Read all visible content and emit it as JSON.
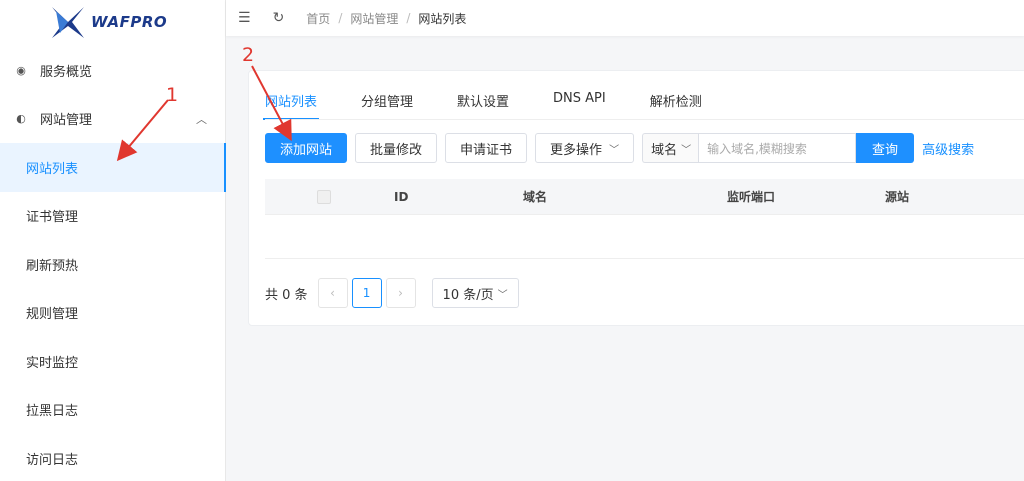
{
  "brand": {
    "name": "WAFPRO"
  },
  "header": {
    "breadcrumb": [
      "首页",
      "网站管理",
      "网站列表"
    ]
  },
  "sidebar": {
    "items": [
      {
        "label": "服务概览",
        "icon": "dashboard-icon"
      },
      {
        "label": "网站管理",
        "icon": "globe-icon"
      },
      {
        "label": "网站列表"
      },
      {
        "label": "证书管理"
      },
      {
        "label": "刷新预热"
      },
      {
        "label": "规则管理"
      },
      {
        "label": "实时监控"
      },
      {
        "label": "拉黑日志"
      },
      {
        "label": "访问日志"
      }
    ]
  },
  "tabs": [
    "网站列表",
    "分组管理",
    "默认设置",
    "DNS API",
    "解析检测"
  ],
  "toolbar": {
    "add_label": "添加网站",
    "batch_label": "批量修改",
    "cert_label": "申请证书",
    "more_label": "更多操作",
    "field_select": "域名",
    "search_placeholder": "输入域名,模糊搜索",
    "query_label": "查询",
    "advanced_label": "高级搜索"
  },
  "table": {
    "columns": [
      "ID",
      "域名",
      "监听端口",
      "源站"
    ]
  },
  "pagination": {
    "total_text": "共 0 条",
    "current_page": "1",
    "page_size": "10 条/页"
  },
  "annotations": [
    "1",
    "2"
  ],
  "colors": {
    "accent": "#1890ff",
    "annotation": "#e0372f"
  }
}
